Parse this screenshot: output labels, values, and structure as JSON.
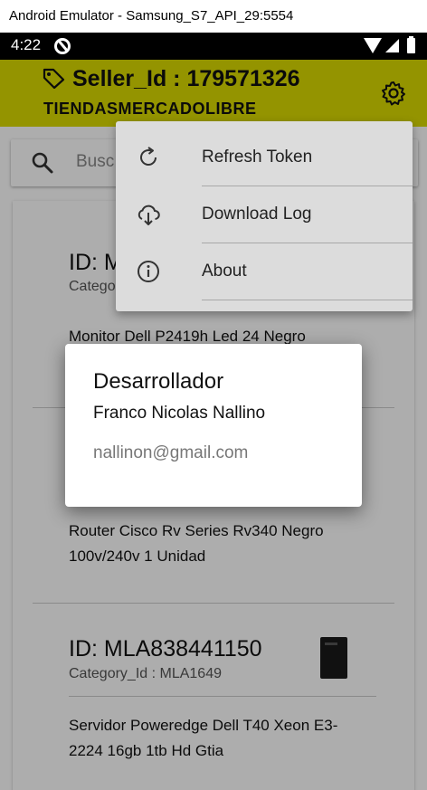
{
  "window": {
    "title": "Android Emulator - Samsung_S7_API_29:5554"
  },
  "status_bar": {
    "time": "4:22"
  },
  "header": {
    "seller_id": "Seller_Id : 179571326",
    "store": "TIENDASMERCADOLIBRE",
    "bg_color": "#dada00"
  },
  "search": {
    "placeholder": "Busc"
  },
  "items": [
    {
      "id": "ID: ML",
      "category": "Catego",
      "title": "Monitor Dell P2419h Led 24 Negro"
    },
    {
      "id": "",
      "category": "",
      "title": "Router Cisco Rv Series Rv340 Negro 100v/240v 1 Unidad"
    },
    {
      "id": "ID: MLA838441150",
      "category": "Category_Id : MLA1649",
      "title": "Servidor Poweredge Dell T40 Xeon E3-2224 16gb 1tb Hd Gtia"
    }
  ],
  "menu": {
    "items": [
      {
        "label": "Refresh Token",
        "icon": "refresh-icon"
      },
      {
        "label": "Download Log",
        "icon": "cloud-download-icon"
      },
      {
        "label": "About",
        "icon": "info-icon"
      }
    ]
  },
  "dialog": {
    "title": "Desarrollador",
    "name": "Franco Nicolas Nallino",
    "email": "nallinon@gmail.com"
  }
}
